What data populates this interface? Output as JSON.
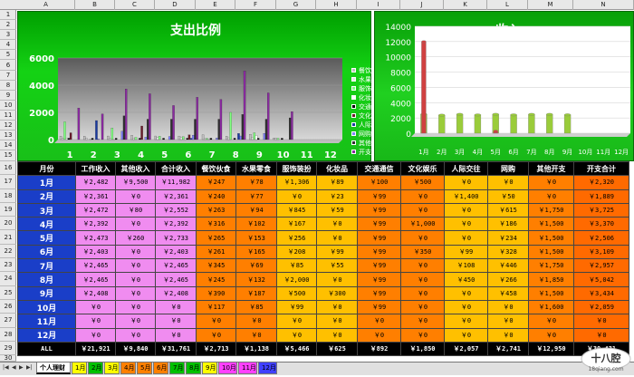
{
  "columns": [
    "A",
    "B",
    "C",
    "D",
    "E",
    "F",
    "G",
    "H",
    "I",
    "J",
    "K",
    "L",
    "M",
    "N"
  ],
  "rows": [
    "1",
    "2",
    "3",
    "4",
    "5",
    "6",
    "7",
    "8",
    "9",
    "10",
    "11",
    "12",
    "13",
    "14",
    "15",
    "16",
    "17",
    "18",
    "19",
    "20",
    "21",
    "22",
    "23",
    "24",
    "25",
    "26",
    "27",
    "28",
    "29",
    "30"
  ],
  "chart_data": [
    {
      "type": "bar",
      "title": "支出比例",
      "categories": [
        "1",
        "2",
        "3",
        "4",
        "5",
        "6",
        "7",
        "8",
        "9",
        "10",
        "11",
        "12"
      ],
      "ylim": [
        0,
        6000
      ],
      "yticks": [
        "0",
        "2000",
        "4000",
        "6000"
      ],
      "legend_position": "right",
      "series": [
        {
          "name": "餐饮伙食",
          "color": "#c0c0c0",
          "values": [
            247,
            240,
            263,
            316,
            265,
            261,
            345,
            245,
            390,
            117,
            0,
            0
          ]
        },
        {
          "name": "水果零食",
          "color": "#e8e8e8",
          "values": [
            78,
            77,
            94,
            102,
            153,
            165,
            69,
            132,
            187,
            85,
            0,
            0
          ]
        },
        {
          "name": "服饰装扮",
          "color": "#80ff80",
          "values": [
            1306,
            0,
            845,
            167,
            256,
            208,
            85,
            2000,
            500,
            99,
            0,
            0
          ]
        },
        {
          "name": "化妆品",
          "color": "#ffffff",
          "values": [
            89,
            23,
            59,
            0,
            0,
            99,
            55,
            0,
            300,
            0,
            0,
            0
          ]
        },
        {
          "name": "交通通信",
          "color": "#000000",
          "values": [
            100,
            99,
            99,
            99,
            99,
            99,
            99,
            99,
            99,
            99,
            0,
            0
          ]
        },
        {
          "name": "文化娱乐",
          "color": "#6a1a2a",
          "values": [
            500,
            0,
            0,
            1000,
            0,
            350,
            0,
            0,
            0,
            0,
            0,
            0
          ]
        },
        {
          "name": "人际交往",
          "color": "#1a3aa0",
          "values": [
            0,
            1400,
            0,
            0,
            0,
            99,
            0,
            450,
            0,
            0,
            0,
            0
          ]
        },
        {
          "name": "网购",
          "color": "#8080ff",
          "values": [
            0,
            50,
            615,
            186,
            234,
            328,
            108,
            266,
            458,
            0,
            0,
            0
          ]
        },
        {
          "name": "其他开支",
          "color": "#303030",
          "values": [
            0,
            0,
            1750,
            1500,
            1500,
            1500,
            1500,
            1850,
            1500,
            1600,
            0,
            0
          ]
        },
        {
          "name": "开支合计",
          "color": "#8a2aa0",
          "values": [
            2320,
            1889,
            3725,
            3370,
            2506,
            3109,
            2957,
            5042,
            3434,
            2059,
            0,
            0
          ]
        }
      ]
    },
    {
      "type": "bar",
      "title": "收入",
      "categories": [
        "1月",
        "2月",
        "3月",
        "4月",
        "5月",
        "6月",
        "7月",
        "8月",
        "9月",
        "10月",
        "11月",
        "12月"
      ],
      "ylim": [
        0,
        14000
      ],
      "yticks": [
        "0",
        "2000",
        "4000",
        "6000",
        "8000",
        "10000",
        "12000",
        "14000"
      ],
      "series": [
        {
          "name": "工作收入",
          "color": "#9acc3a",
          "values": [
            2482,
            2361,
            2472,
            2392,
            2473,
            2403,
            2465,
            2465,
            2408,
            0,
            0,
            0
          ]
        },
        {
          "name": "合计收入",
          "color": "#d04040",
          "values": [
            11982,
            0,
            0,
            0,
            260,
            0,
            0,
            0,
            0,
            0,
            0,
            0
          ]
        }
      ]
    }
  ],
  "table": {
    "headers": [
      "月份",
      "工作收入",
      "其他收入",
      "合计收入",
      "餐饮伙食",
      "水果零食",
      "服饰装扮",
      "化妆品",
      "交通通信",
      "文化娱乐",
      "人际交往",
      "网购",
      "其他开支",
      "开支合计"
    ],
    "rows": [
      [
        "1月",
        "￥2,482",
        "￥9,500",
        "￥11,982",
        "￥247",
        "￥78",
        "￥1,306",
        "￥89",
        "￥100",
        "￥500",
        "￥0",
        "￥0",
        "￥0",
        "￥2,320"
      ],
      [
        "2月",
        "￥2,361",
        "￥0",
        "￥2,361",
        "￥240",
        "￥77",
        "￥0",
        "￥23",
        "￥99",
        "￥0",
        "￥1,400",
        "￥50",
        "￥0",
        "￥1,889"
      ],
      [
        "3月",
        "￥2,472",
        "￥80",
        "￥2,552",
        "￥263",
        "￥94",
        "￥845",
        "￥59",
        "￥99",
        "￥0",
        "￥0",
        "￥615",
        "￥1,750",
        "￥3,725"
      ],
      [
        "4月",
        "￥2,392",
        "￥0",
        "￥2,392",
        "￥316",
        "￥102",
        "￥167",
        "￥0",
        "￥99",
        "￥1,000",
        "￥0",
        "￥186",
        "￥1,500",
        "￥3,370"
      ],
      [
        "5月",
        "￥2,473",
        "￥260",
        "￥2,733",
        "￥265",
        "￥153",
        "￥256",
        "￥0",
        "￥99",
        "￥0",
        "￥0",
        "￥234",
        "￥1,500",
        "￥2,506"
      ],
      [
        "6月",
        "￥2,403",
        "￥0",
        "￥2,403",
        "￥261",
        "￥165",
        "￥208",
        "￥99",
        "￥99",
        "￥350",
        "￥99",
        "￥328",
        "￥1,500",
        "￥3,109"
      ],
      [
        "7月",
        "￥2,465",
        "￥0",
        "￥2,465",
        "￥345",
        "￥69",
        "￥85",
        "￥55",
        "￥99",
        "￥0",
        "￥108",
        "￥446",
        "￥1,750",
        "￥2,957"
      ],
      [
        "8月",
        "￥2,465",
        "￥0",
        "￥2,465",
        "￥245",
        "￥132",
        "￥2,000",
        "￥0",
        "￥99",
        "￥0",
        "￥450",
        "￥266",
        "￥1,850",
        "￥5,042"
      ],
      [
        "9月",
        "￥2,408",
        "￥0",
        "￥2,408",
        "￥390",
        "￥187",
        "￥500",
        "￥300",
        "￥99",
        "￥0",
        "￥0",
        "￥458",
        "￥1,500",
        "￥3,434"
      ],
      [
        "10月",
        "￥0",
        "￥0",
        "￥0",
        "￥117",
        "￥85",
        "￥99",
        "￥0",
        "￥99",
        "￥0",
        "￥0",
        "￥0",
        "￥1,600",
        "￥2,059"
      ],
      [
        "11月",
        "￥0",
        "￥0",
        "￥0",
        "￥0",
        "￥0",
        "￥0",
        "￥0",
        "￥0",
        "￥0",
        "￥0",
        "￥0",
        "￥0",
        "￥0"
      ],
      [
        "12月",
        "￥0",
        "￥0",
        "￥0",
        "￥0",
        "￥0",
        "￥0",
        "￥0",
        "￥0",
        "￥0",
        "￥0",
        "￥0",
        "￥0",
        "￥0"
      ]
    ],
    "total": [
      "ALL",
      "￥21,921",
      "￥9,840",
      "￥31,761",
      "￥2,713",
      "￥1,138",
      "￥5,466",
      "￥625",
      "￥892",
      "￥1,850",
      "￥2,057",
      "￥2,741",
      "￥12,950",
      "￥30,431"
    ]
  },
  "sheet_tabs": [
    "个人理财",
    "1月",
    "2月",
    "3月",
    "4月",
    "5月",
    "6月",
    "7月",
    "8月",
    "9月",
    "10月",
    "11月",
    "12月"
  ],
  "tab_colors": [
    "#ffffff",
    "#ffff00",
    "#00c000",
    "#ffff00",
    "#ff8000",
    "#ff8000",
    "#ff8000",
    "#00c000",
    "#00c000",
    "#ffff00",
    "#ff40ff",
    "#ff40ff",
    "#4040ff"
  ],
  "active_tab": "个人理财",
  "logo": {
    "text": "十八腔",
    "url": "18qiang.com"
  }
}
